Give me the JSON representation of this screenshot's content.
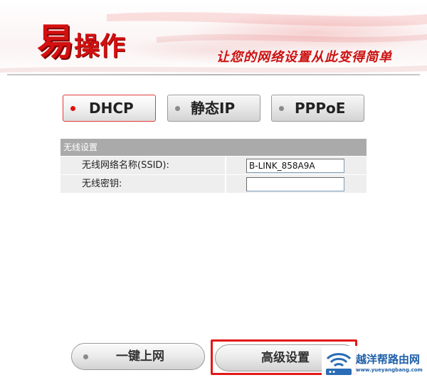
{
  "header": {
    "logo_main": "易",
    "logo_rest": "操作",
    "slogan": "让您的网络设置从此变得简单"
  },
  "modes": [
    {
      "label": "DHCP",
      "active": true
    },
    {
      "label": "静态IP",
      "active": false
    },
    {
      "label": "PPPoE",
      "active": false
    }
  ],
  "wireless": {
    "section_title": "无线设置",
    "ssid_label": "无线网络名称(SSID):",
    "ssid_value": "B-LINK_858A9A",
    "password_label": "无线密钥:",
    "password_value": ""
  },
  "bottom": {
    "onekey_label": "一键上网",
    "advanced_label": "高级设置"
  },
  "watermark": {
    "title": "越洋帮路由网",
    "url": "www.yueyangbang.com"
  },
  "colors": {
    "brand_red": "#d40f0f",
    "highlight_red": "#e21818",
    "section_gray": "#aaaaaa",
    "watermark_blue": "#1e5fa8"
  }
}
